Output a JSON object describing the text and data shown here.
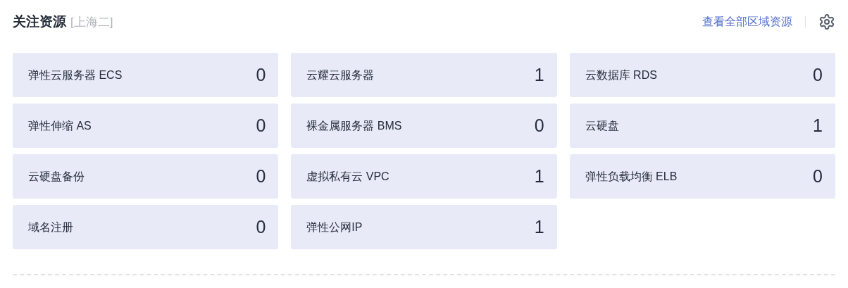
{
  "header": {
    "title": "关注资源",
    "region": "[上海二]",
    "link": "查看全部区域资源"
  },
  "resources": [
    {
      "name": "弹性云服务器 ECS",
      "count": "0"
    },
    {
      "name": "云耀云服务器",
      "count": "1"
    },
    {
      "name": "云数据库 RDS",
      "count": "0"
    },
    {
      "name": "弹性伸缩 AS",
      "count": "0"
    },
    {
      "name": "裸金属服务器 BMS",
      "count": "0"
    },
    {
      "name": "云硬盘",
      "count": "1"
    },
    {
      "name": "云硬盘备份",
      "count": "0"
    },
    {
      "name": "虚拟私有云 VPC",
      "count": "1"
    },
    {
      "name": "弹性负载均衡 ELB",
      "count": "0"
    },
    {
      "name": "域名注册",
      "count": "0"
    },
    {
      "name": "弹性公网IP",
      "count": "1"
    }
  ]
}
